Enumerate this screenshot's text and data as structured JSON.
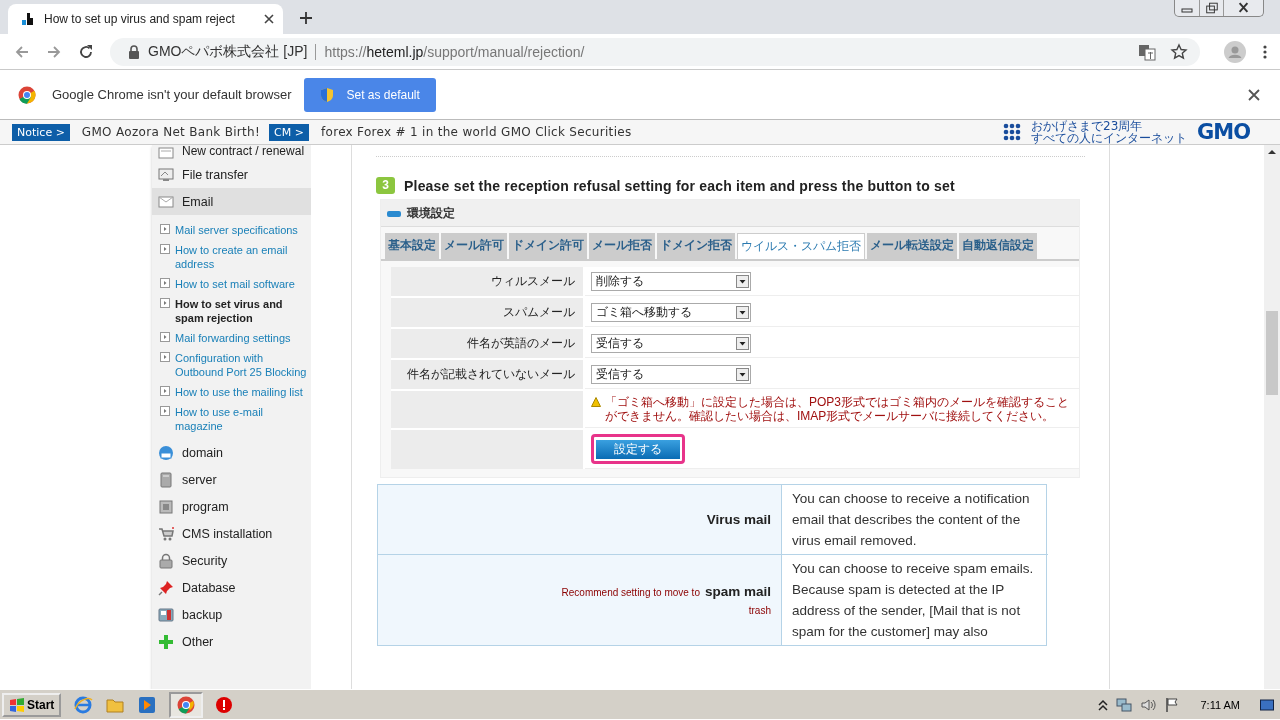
{
  "browser": {
    "tab_title": "How to set up virus and spam reject",
    "site_name": "GMOペパボ株式会社 [JP]",
    "url_scheme": "https://",
    "url_host": "heteml.jp",
    "url_path": "/support/manual/rejection/"
  },
  "infobar": {
    "message": "Google Chrome isn't your default browser",
    "button": "Set as default"
  },
  "notices": [
    {
      "badge": "Notice >",
      "text": "GMO Aozora Net Bank Birth!"
    },
    {
      "badge": "CM >",
      "text": "forex Forex # 1 in the world GMO Click Securities"
    }
  ],
  "brand": {
    "tagline_1": "おかげさまで23周年",
    "tagline_2": "すべての人にインターネット",
    "wordmark": "GMO"
  },
  "sidebar": {
    "items": [
      {
        "label": "New contract / renewal",
        "selected": false
      },
      {
        "label": "File transfer",
        "selected": false
      },
      {
        "label": "Email",
        "selected": true,
        "children": [
          {
            "label": "Mail server specifications",
            "selected": false
          },
          {
            "label": "How to create an email address",
            "selected": false
          },
          {
            "label": "How to set mail software",
            "selected": false
          },
          {
            "label": "How to set virus and spam rejection",
            "selected": true
          },
          {
            "label": "Mail forwarding settings",
            "selected": false
          },
          {
            "label": "Configuration with Outbound Port 25 Blocking",
            "selected": false
          },
          {
            "label": "How to use the mailing list",
            "selected": false
          },
          {
            "label": "How to use e-mail magazine",
            "selected": false
          }
        ]
      },
      {
        "label": "domain",
        "selected": false
      },
      {
        "label": "server",
        "selected": false
      },
      {
        "label": "program",
        "selected": false
      },
      {
        "label": "CMS installation",
        "selected": false
      },
      {
        "label": "Security",
        "selected": false
      },
      {
        "label": "Database",
        "selected": false
      },
      {
        "label": "backup",
        "selected": false
      },
      {
        "label": "Other",
        "selected": false
      }
    ]
  },
  "step": {
    "number": "3",
    "title": "Please set the reception refusal setting for each item and press the button to set"
  },
  "panel": {
    "title": "環境設定",
    "tabs": [
      {
        "label": "基本設定",
        "selected": false
      },
      {
        "label": "メール許可",
        "selected": false
      },
      {
        "label": "ドメイン許可",
        "selected": false
      },
      {
        "label": "メール拒否",
        "selected": false
      },
      {
        "label": "ドメイン拒否",
        "selected": false
      },
      {
        "label": "ウイルス・スパム拒否",
        "selected": true
      },
      {
        "label": "メール転送設定",
        "selected": false
      },
      {
        "label": "自動返信設定",
        "selected": false
      }
    ],
    "rows": [
      {
        "label": "ウィルスメール",
        "value": "削除する"
      },
      {
        "label": "スパムメール",
        "value": "ゴミ箱へ移動する"
      },
      {
        "label": "件名が英語のメール",
        "value": "受信する"
      },
      {
        "label": "件名が記載されていないメール",
        "value": "受信する"
      }
    ],
    "warning": "「ゴミ箱へ移動」に設定した場合は、POP3形式ではゴミ箱内のメールを確認することができません。確認したい場合は、IMAP形式でメールサーバに接続してください。",
    "button": "設定する"
  },
  "descriptions": [
    {
      "term": "Virus mail",
      "description": "You can choose to receive a notification email that describes the content of the virus email removed."
    },
    {
      "term": "spam mail",
      "note_before": "Recommend setting to move to",
      "note_after": "trash",
      "description": "You can choose to receive spam emails. Because spam is detected at the IP address of the sender, [Mail that is not spam for the customer] may also"
    }
  ],
  "taskbar": {
    "start": "Start",
    "time": "7:11 AM"
  }
}
